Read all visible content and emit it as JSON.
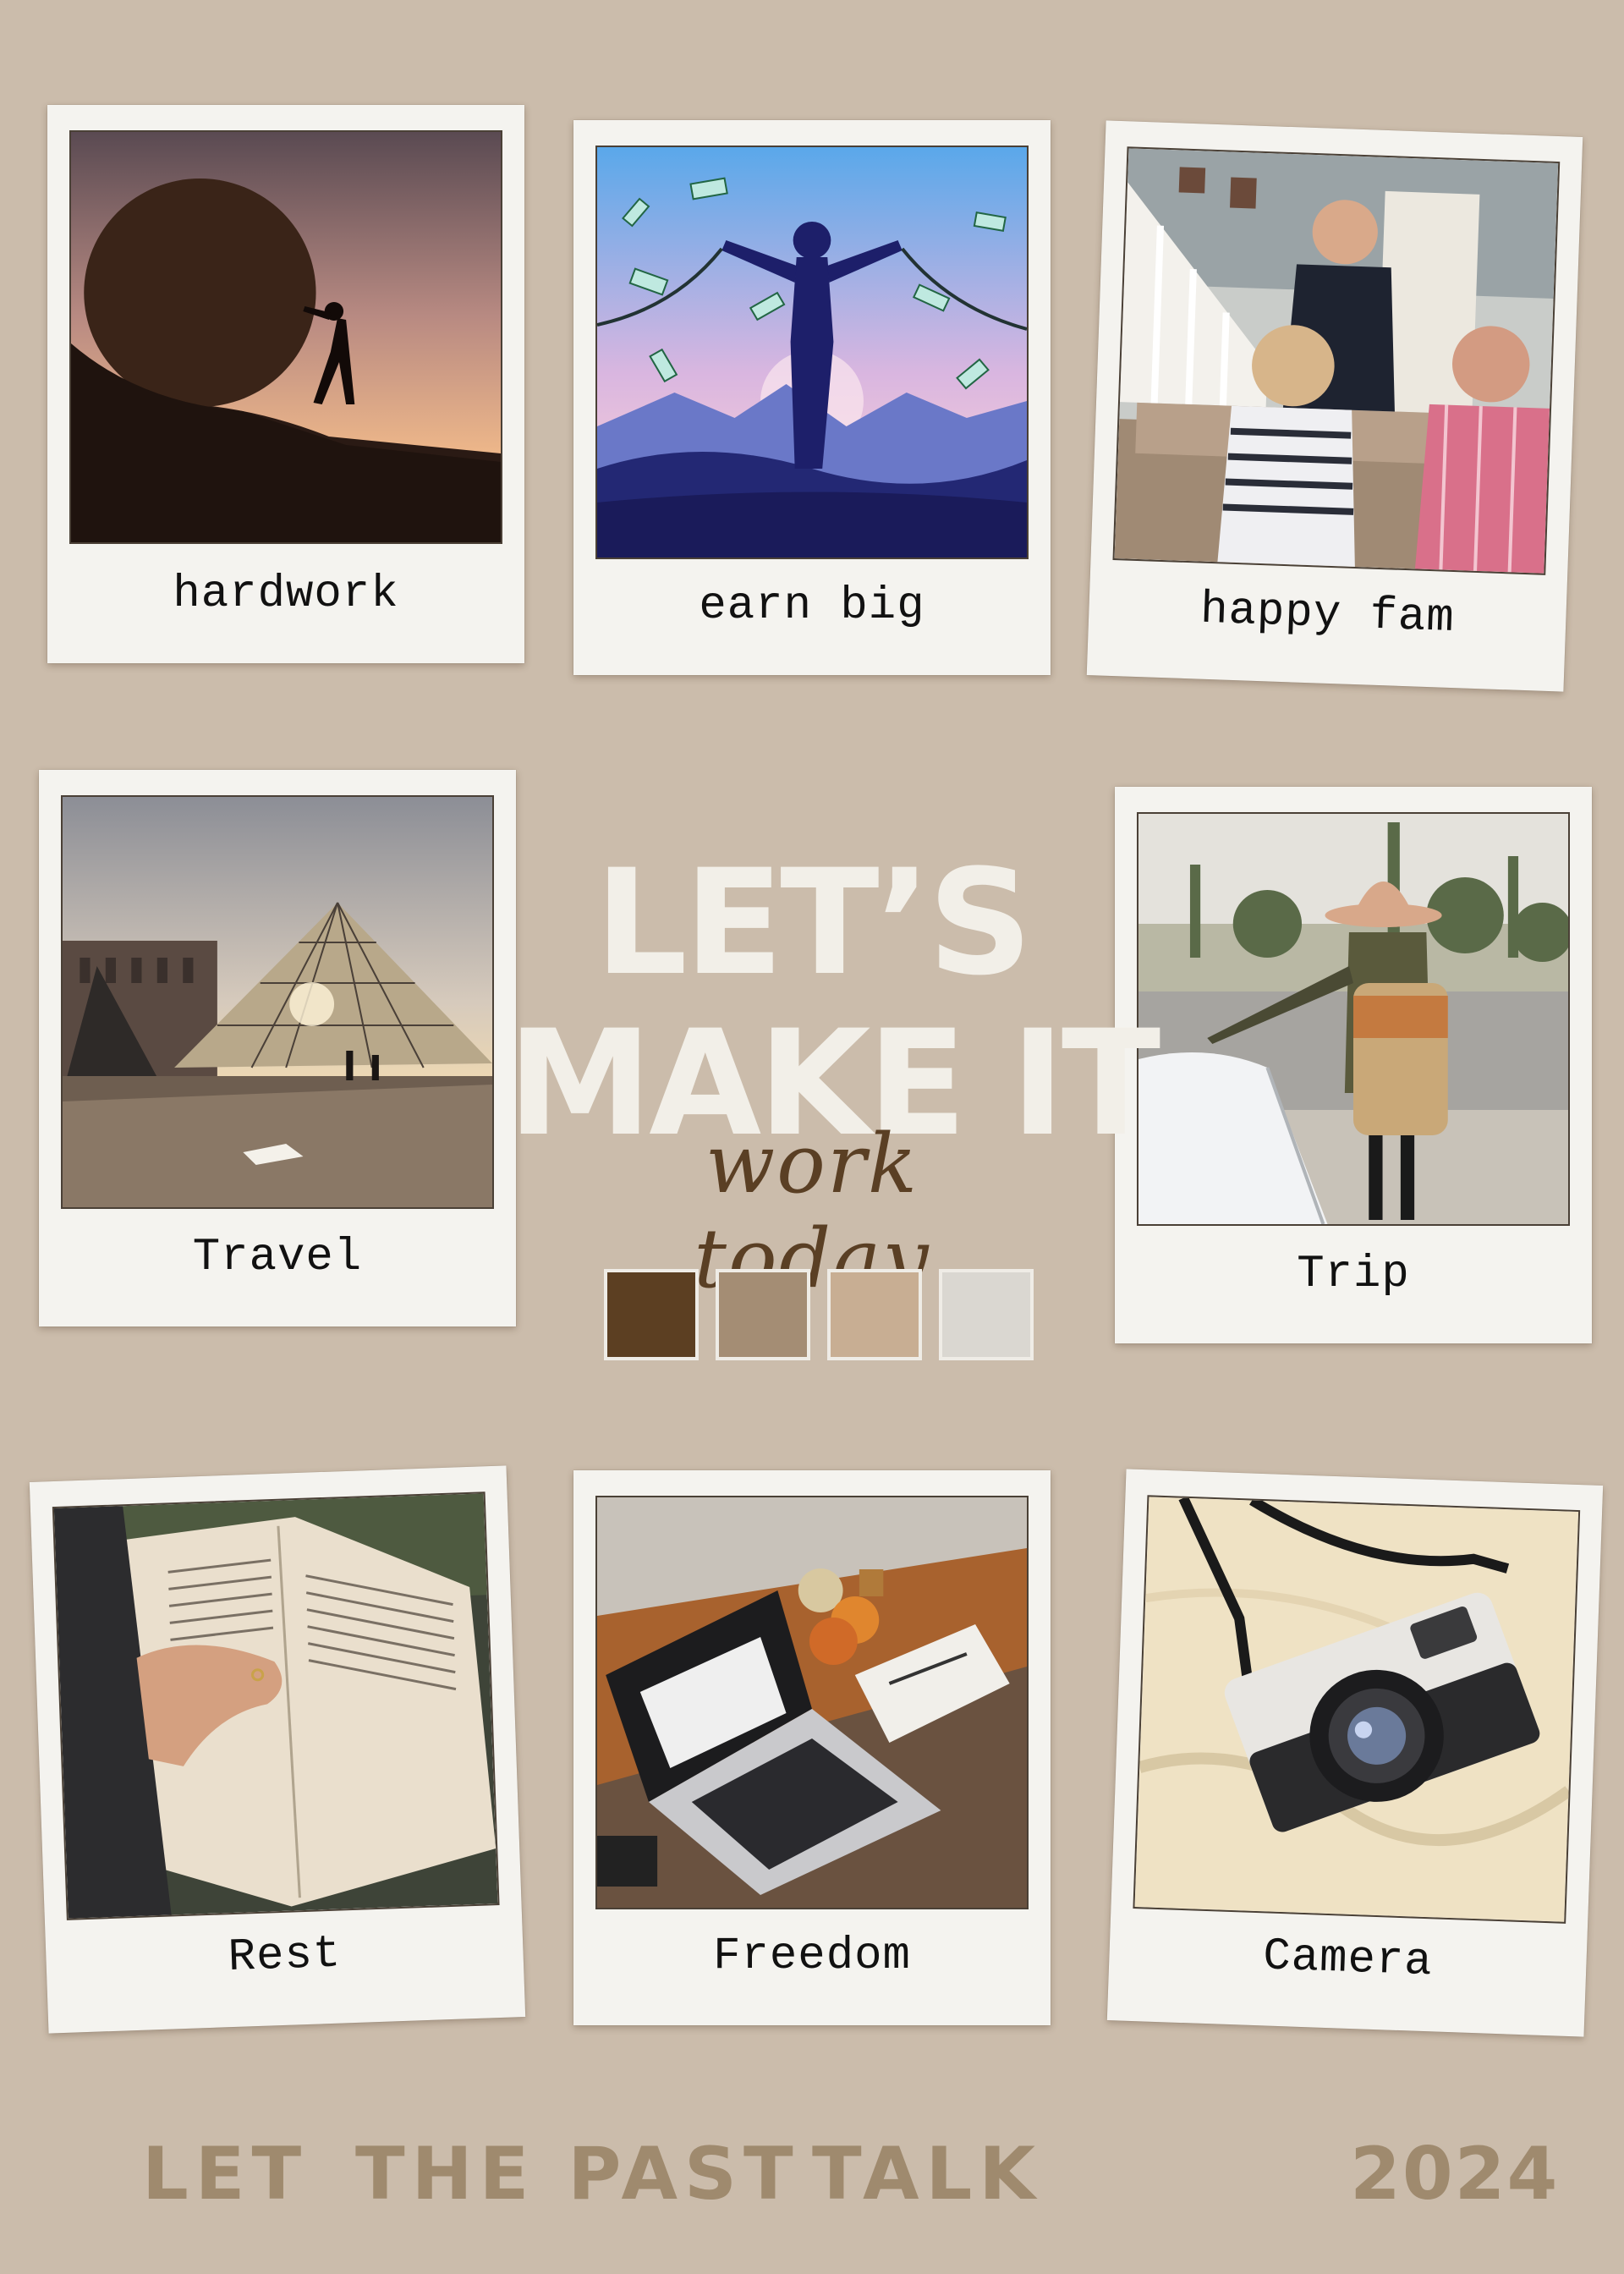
{
  "cards": [
    {
      "id": "hardwork",
      "caption": "hardwork",
      "scene": "man-pushing-boulder-photo"
    },
    {
      "id": "earn-big",
      "caption": "earn big",
      "scene": "breaking-chains-money-illustration"
    },
    {
      "id": "happy-fam",
      "caption": "happy fam",
      "scene": "family-on-couch-photo"
    },
    {
      "id": "travel",
      "caption": "Travel",
      "scene": "louvre-pyramid-photo"
    },
    {
      "id": "trip",
      "caption": "Trip",
      "scene": "backpacker-roadside-photo"
    },
    {
      "id": "rest",
      "caption": "Rest",
      "scene": "reading-book-photo"
    },
    {
      "id": "freedom",
      "caption": "Freedom",
      "scene": "laptop-desk-photo"
    },
    {
      "id": "camera",
      "caption": "Camera",
      "scene": "camera-on-blanket-photo"
    }
  ],
  "headline": {
    "line1": "LET’S",
    "line2": "MAKE IT",
    "script": "work today"
  },
  "palette": [
    "#5c3f22",
    "#a48d74",
    "#c8ae93",
    "#dad7d1"
  ],
  "footer": {
    "word1": "LET",
    "word2": "THE PAST",
    "word3": "TALK",
    "year": "2024"
  }
}
